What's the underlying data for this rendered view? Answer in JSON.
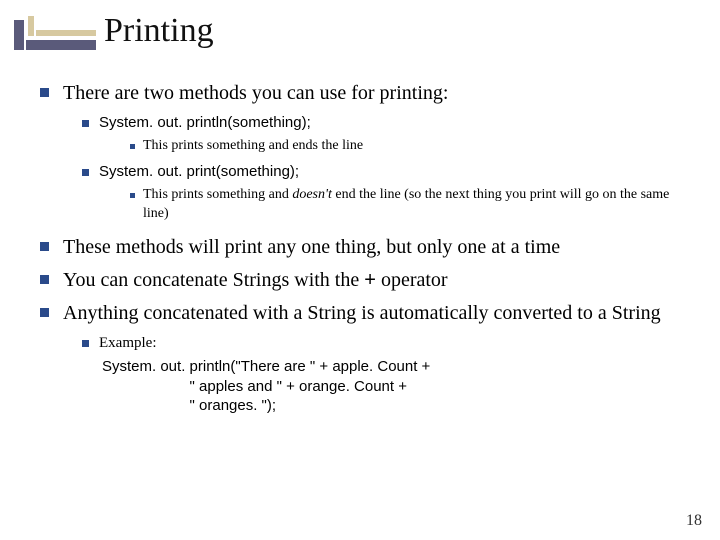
{
  "title": "Printing",
  "b1": "There are two methods you can use for printing:",
  "b1a": "System. out. println(something);",
  "b1a1": "This prints something and ends the line",
  "b1b": "System. out. print(something);",
  "b1b1_pre": "This prints something and ",
  "b1b1_em": "doesn't",
  "b1b1_post": " end the line (so the next thing you print will go on the same line)",
  "b2_pre": "These methods will print any ",
  "b2_strong": "one",
  "b2_post": " thing, but only one at a time",
  "b3_pre": "You can concatenate Strings with the ",
  "b3_code": "+",
  "b3_post": " operator",
  "b4": "Anything concatenated with a String is automatically converted to a String",
  "b4a": "Example:",
  "code1": "System. out. println(\"There are \" + apple. Count +",
  "code2": "                     \" apples and \" + orange. Count +",
  "code3": "                     \" oranges. \");",
  "page": "18"
}
